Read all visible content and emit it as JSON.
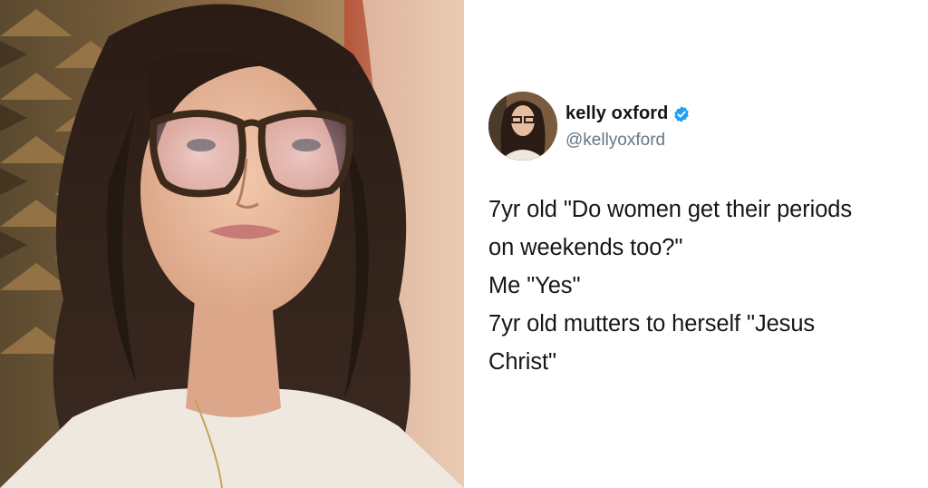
{
  "tweet": {
    "display_name": "kelly oxford",
    "handle": "@kellyoxford",
    "verified": true,
    "lines": [
      "7yr old \"Do women get their periods",
      "on weekends too?\"",
      "Me \"Yes\"",
      "7yr old mutters to herself \"Jesus",
      "Christ\""
    ]
  },
  "colors": {
    "verified_badge": "#1da1f2",
    "name_text": "#14171a",
    "handle_text": "#657786"
  },
  "icons": {
    "verified": "verified-badge-icon"
  }
}
